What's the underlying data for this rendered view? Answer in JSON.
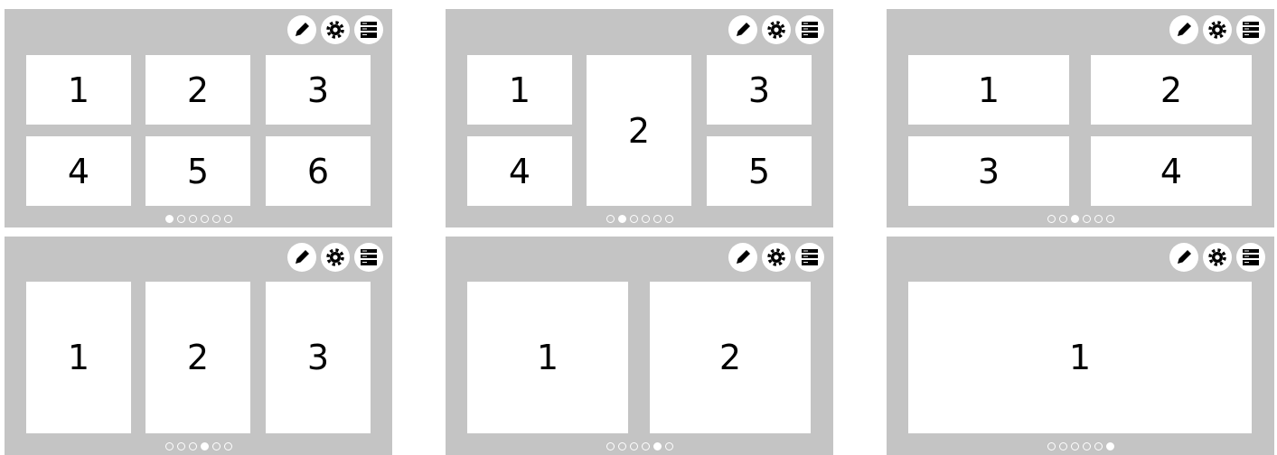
{
  "screens": [
    {
      "tiles": [
        {
          "label": "1"
        },
        {
          "label": "2"
        },
        {
          "label": "3"
        },
        {
          "label": "4"
        },
        {
          "label": "5"
        },
        {
          "label": "6"
        }
      ],
      "pager": {
        "count": 6,
        "active": 1
      }
    },
    {
      "tiles": [
        {
          "label": "1"
        },
        {
          "label": "2"
        },
        {
          "label": "3"
        },
        {
          "label": "4"
        },
        {
          "label": "5"
        }
      ],
      "pager": {
        "count": 6,
        "active": 2
      }
    },
    {
      "tiles": [
        {
          "label": "1"
        },
        {
          "label": "2"
        },
        {
          "label": "3"
        },
        {
          "label": "4"
        }
      ],
      "pager": {
        "count": 6,
        "active": 3
      }
    },
    {
      "tiles": [
        {
          "label": "1"
        },
        {
          "label": "2"
        },
        {
          "label": "3"
        }
      ],
      "pager": {
        "count": 6,
        "active": 4
      }
    },
    {
      "tiles": [
        {
          "label": "1"
        },
        {
          "label": "2"
        }
      ],
      "pager": {
        "count": 6,
        "active": 5
      }
    },
    {
      "tiles": [
        {
          "label": "1"
        }
      ],
      "pager": {
        "count": 6,
        "active": 6
      }
    }
  ],
  "toolbar_icons": [
    "pencil-icon",
    "gear-icon",
    "layout-icon"
  ],
  "colors": {
    "panel": "#c4c4c4",
    "tile": "#ffffff",
    "text": "#000000",
    "icon": "#000000"
  }
}
